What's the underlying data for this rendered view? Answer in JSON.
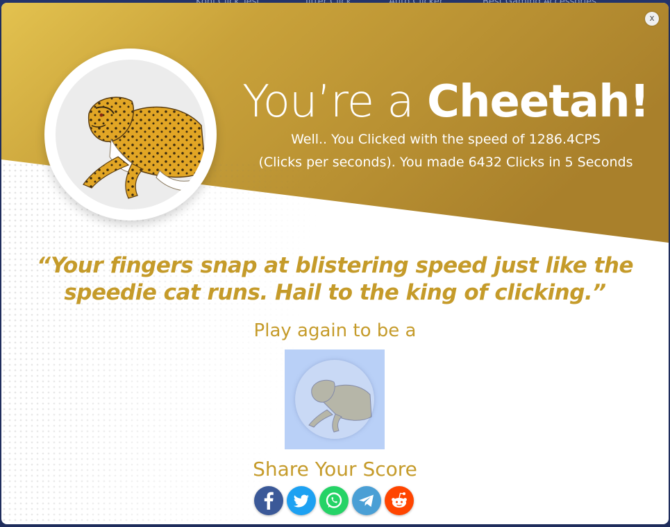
{
  "background_nav": {
    "items": [
      "Kohi Click Test",
      "Jitter Click",
      "Auto Clicker",
      "Best Gaming Accessories"
    ]
  },
  "modal": {
    "close_label": "x",
    "headline_prefix": "You’re a ",
    "headline_animal": "Cheetah!",
    "result_line_1": "Well.. You Clicked with the speed of 1286.4CPS",
    "result_line_2": "(Clicks per seconds). You made 6432 Clicks in 5 Seconds",
    "quote_line_1": "“Your fingers snap at blistering speed just like the",
    "quote_line_2": "speedie cat runs. Hail to the king of clicking.”",
    "play_again": "Play again to be a",
    "share_title": "Share Your Score",
    "share_buttons": [
      {
        "name": "facebook",
        "icon": "facebook-icon",
        "color": "#3b5998"
      },
      {
        "name": "twitter",
        "icon": "twitter-icon",
        "color": "#1da1f2"
      },
      {
        "name": "whatsapp",
        "icon": "whatsapp-icon",
        "color": "#25d366"
      },
      {
        "name": "telegram",
        "icon": "telegram-icon",
        "color": "#4a9fd5"
      },
      {
        "name": "reddit",
        "icon": "reddit-icon",
        "color": "#ff4500"
      }
    ]
  },
  "colors": {
    "gold": "#c59b2a",
    "gold_dark": "#a8812a",
    "badge_blue": "#b9d0f7"
  },
  "icons": {
    "hero_image": "cheetah-icon",
    "next_badge_image": "cheetah-icon"
  }
}
